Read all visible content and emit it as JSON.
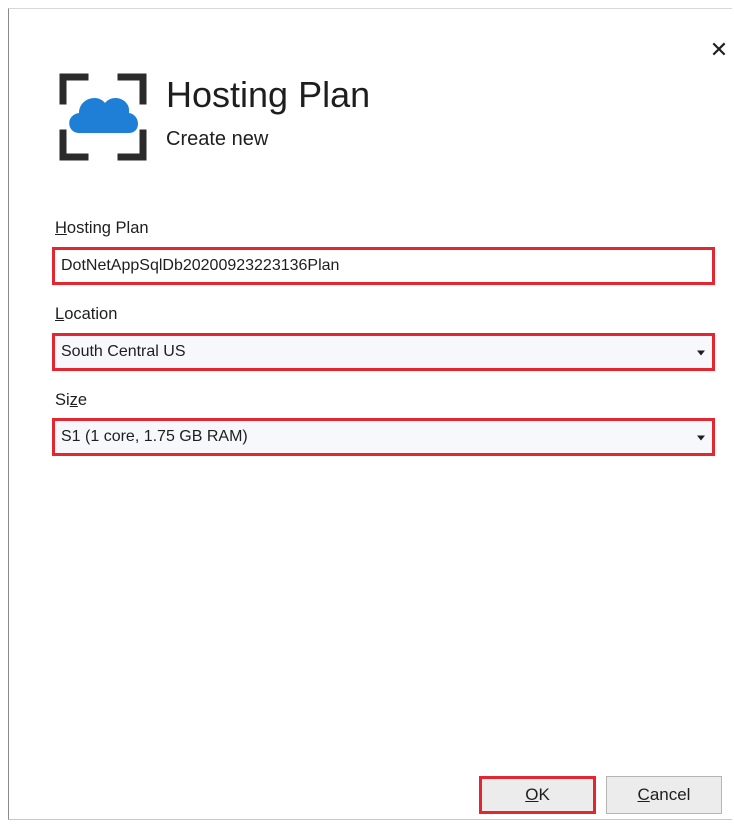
{
  "dialog": {
    "title": "Hosting Plan",
    "subtitle": "Create new",
    "close_glyph": "✕"
  },
  "fields": {
    "hosting_plan": {
      "label_mnemonic": "H",
      "label_rest": "osting Plan",
      "value": "DotNetAppSqlDb20200923223136Plan"
    },
    "location": {
      "label_mnemonic": "L",
      "label_rest": "ocation",
      "value": "South Central US"
    },
    "size": {
      "label_prefix": "Si",
      "label_mnemonic": "z",
      "label_rest": "e",
      "value": "S1 (1 core, 1.75 GB RAM)"
    }
  },
  "buttons": {
    "ok": {
      "mnemonic": "O",
      "rest": "K"
    },
    "cancel": {
      "mnemonic": "C",
      "rest": "ancel"
    }
  },
  "colors": {
    "highlight_border": "#e3262f",
    "cloud_blue": "#1f7fd6",
    "bracket_dark": "#2b2b2b"
  },
  "icons": {
    "header": "cloud-in-brackets-icon",
    "close": "close-icon",
    "dropdown": "chevron-down-icon"
  }
}
